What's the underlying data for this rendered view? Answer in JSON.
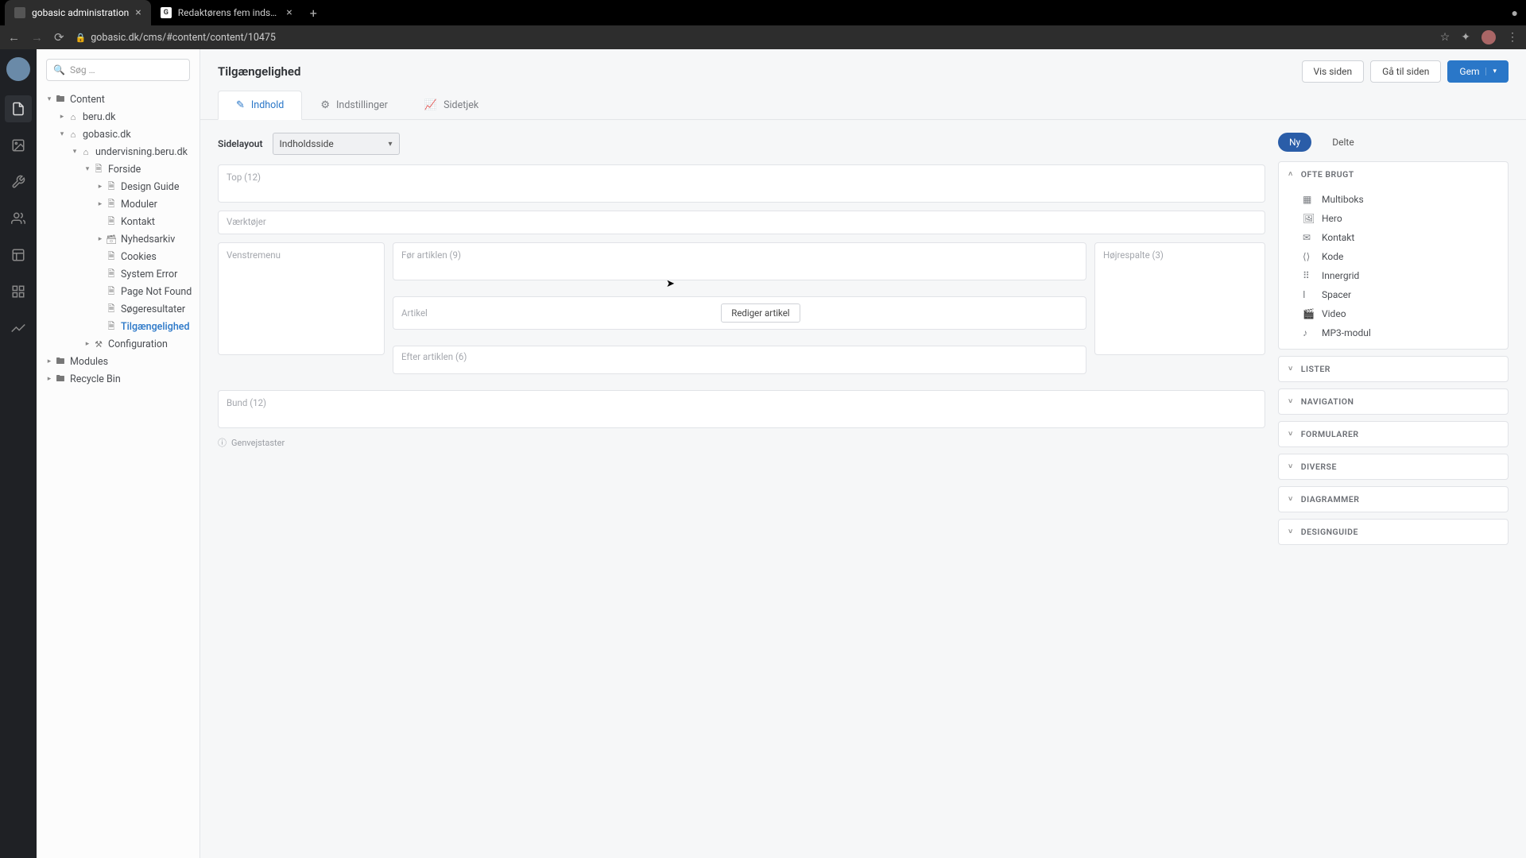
{
  "browser": {
    "tabs": [
      {
        "title": "gobasic administration",
        "active": true
      },
      {
        "title": "Redaktørens fem indsatsområ…",
        "active": false
      }
    ],
    "url": "gobasic.dk/cms/#content/content/10475"
  },
  "sidebar": {
    "search_placeholder": "Søg …"
  },
  "tree": [
    {
      "indent": 0,
      "caret": "▾",
      "icon": "folder",
      "label": "Content"
    },
    {
      "indent": 1,
      "caret": "▸",
      "icon": "home",
      "label": "beru.dk"
    },
    {
      "indent": 1,
      "caret": "▾",
      "icon": "home",
      "label": "gobasic.dk"
    },
    {
      "indent": 2,
      "caret": "▾",
      "icon": "home",
      "label": "undervisning.beru.dk"
    },
    {
      "indent": 3,
      "caret": "▾",
      "icon": "page",
      "label": "Forside"
    },
    {
      "indent": 4,
      "caret": "▸",
      "icon": "page",
      "label": "Design Guide"
    },
    {
      "indent": 4,
      "caret": "▸",
      "icon": "page",
      "label": "Moduler"
    },
    {
      "indent": 4,
      "caret": "",
      "icon": "page",
      "label": "Kontakt"
    },
    {
      "indent": 4,
      "caret": "▸",
      "icon": "archive",
      "label": "Nyhedsarkiv"
    },
    {
      "indent": 4,
      "caret": "",
      "icon": "page",
      "label": "Cookies"
    },
    {
      "indent": 4,
      "caret": "",
      "icon": "page",
      "label": "System Error"
    },
    {
      "indent": 4,
      "caret": "",
      "icon": "page",
      "label": "Page Not Found"
    },
    {
      "indent": 4,
      "caret": "",
      "icon": "page",
      "label": "Søgeresultater"
    },
    {
      "indent": 4,
      "caret": "",
      "icon": "page",
      "label": "Tilgængelighed",
      "selected": true
    },
    {
      "indent": 3,
      "caret": "▸",
      "icon": "config",
      "label": "Configuration"
    },
    {
      "indent": 0,
      "caret": "▸",
      "icon": "folder",
      "label": "Modules"
    },
    {
      "indent": 0,
      "caret": "▸",
      "icon": "folder",
      "label": "Recycle Bin"
    }
  ],
  "header": {
    "title": "Tilgængelighed",
    "view_page": "Vis siden",
    "goto_page": "Gå til siden",
    "save": "Gem"
  },
  "tabs": {
    "content": "Indhold",
    "settings": "Indstillinger",
    "pagecheck": "Sidetjek"
  },
  "layout": {
    "field_label": "Sidelayout",
    "select_value": "Indholdsside",
    "top": "Top (12)",
    "tools": "Værktøjer",
    "leftmenu": "Venstremenu",
    "before": "Før artiklen (9)",
    "article": "Artikel",
    "edit_article": "Rediger artikel",
    "after": "Efter artiklen (6)",
    "rightcol": "Højrespalte (3)",
    "bottom": "Bund (12)",
    "shortcuts": "Genvejstaster"
  },
  "modules": {
    "tab_new": "Ny",
    "tab_shared": "Delte",
    "sections": {
      "often_used": "OFTE BRUGT",
      "lists": "LISTER",
      "navigation": "NAVIGATION",
      "forms": "FORMULARER",
      "diverse": "DIVERSE",
      "diagrams": "DIAGRAMMER",
      "designguide": "DESIGNGUIDE"
    },
    "often_used_items": [
      {
        "icon": "▦",
        "label": "Multiboks"
      },
      {
        "icon": "🖼",
        "label": "Hero"
      },
      {
        "icon": "✉",
        "label": "Kontakt"
      },
      {
        "icon": "⟨⟩",
        "label": "Kode"
      },
      {
        "icon": "⠿",
        "label": "Innergrid"
      },
      {
        "icon": "Ⅰ",
        "label": "Spacer"
      },
      {
        "icon": "🎬",
        "label": "Video"
      },
      {
        "icon": "♪",
        "label": "MP3-modul"
      }
    ]
  }
}
